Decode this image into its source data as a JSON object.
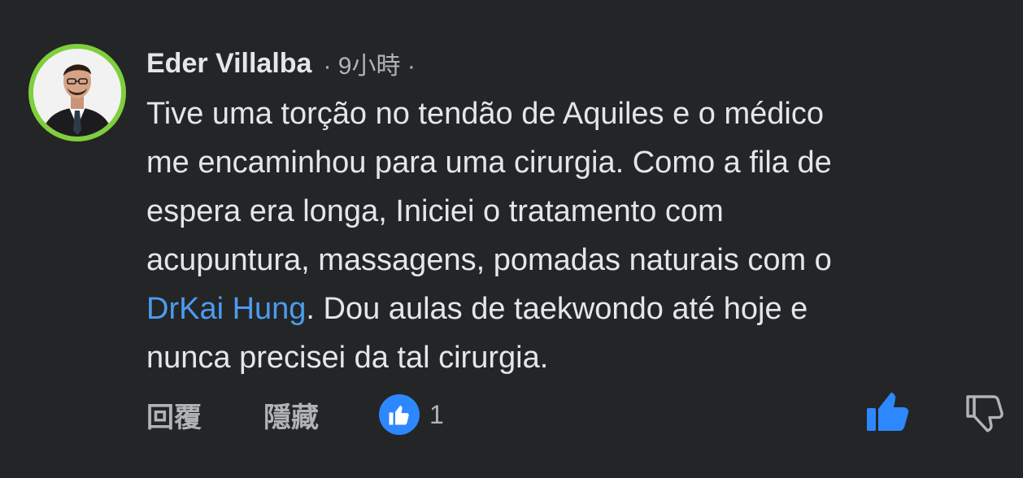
{
  "comment": {
    "author": "Eder Villalba",
    "meta": "· 9小時 ·",
    "body_lines": [
      "Tive uma torção no tendão de Aquiles e o médico",
      "me encaminhou para uma cirurgia. Como a fila de",
      "espera era longa, Iniciei o tratamento com",
      "acupuntura, massagens, pomadas naturais com o"
    ],
    "mention": "DrKai Hung",
    "line5_after_mention": ". Dou aulas de taekwondo até hoje e",
    "line6": "nunca precisei da tal cirurgia."
  },
  "actions": {
    "reply_label": "回覆",
    "hide_label": "隱藏",
    "reaction_count": "1"
  },
  "icons": {
    "avatar": "profile-photo",
    "reaction_badge": "like-badge-icon",
    "like": "thumbs-up-icon",
    "dislike": "thumbs-down-icon"
  },
  "colors": {
    "background": "#242526",
    "text": "#e4e6eb",
    "secondary_text": "#b0b3b8",
    "mention": "#4b9cf0",
    "like_blue": "#2d88ff",
    "avatar_ring": "#7fcf3c"
  }
}
